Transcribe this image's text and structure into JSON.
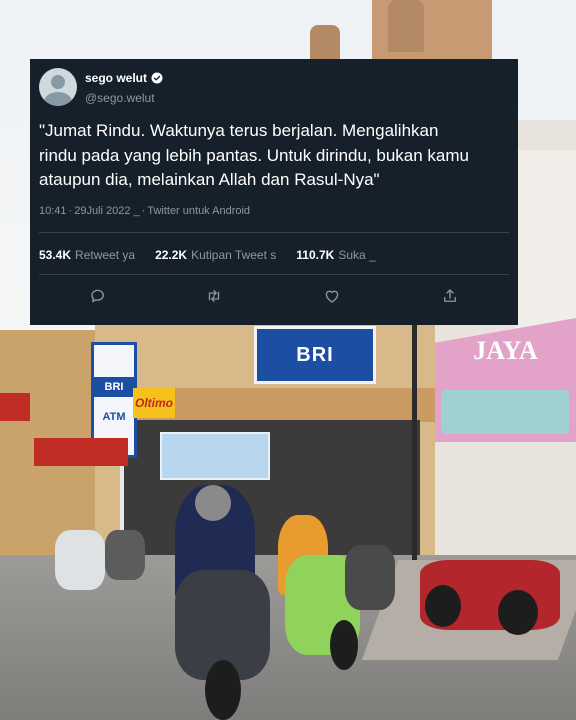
{
  "tweet": {
    "display_name": "sego welut",
    "handle": "@sego.welut",
    "verified": true,
    "text_lines": [
      "\"Jumat Rindu. Waktunya terus berjalan. Mengalihkan",
      "rindu pada yang lebih pantas. Untuk dirindu, bukan kamu",
      "ataupun dia, melainkan Allah dan Rasul-Nya\""
    ],
    "time": "10:41",
    "sep1": "·",
    "date": "29Juli 2022 _",
    "sep2": "·",
    "source": "Twitter untuk Android",
    "stats": {
      "retweets_count": "53.4K",
      "retweets_label": "Retweet ya",
      "quotes_count": "22.2K",
      "quotes_label": "Kutipan Tweet s",
      "likes_count": "110.7K",
      "likes_label": "Suka _"
    },
    "actions": {
      "reply_icon": "comment-icon",
      "retweet_icon": "retweet-icon",
      "like_icon": "heart-icon",
      "share_icon": "share-icon"
    }
  },
  "background_signs": {
    "bri": "BRI",
    "atm_brand": "BRI",
    "atm": "ATM",
    "oltimo": "Oltimo",
    "jaya": "JAYA"
  },
  "colors": {
    "card_bg": "#15202b",
    "text_primary": "#ffffff",
    "text_secondary": "#8b98a5",
    "divider": "#38444d"
  }
}
